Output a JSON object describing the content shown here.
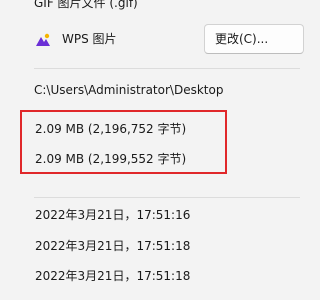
{
  "file_type": {
    "value": "GIF 图片文件 (.gif)"
  },
  "open_with": {
    "app_icon": "wps-picture-icon",
    "app_name": "WPS 图片",
    "change_button_label": "更改(C)..."
  },
  "location": {
    "value": "C:\\Users\\Administrator\\Desktop"
  },
  "size": {
    "value": "2.09 MB (2,196,752 字节)"
  },
  "size_on_disk": {
    "value": "2.09 MB (2,199,552 字节)"
  },
  "dates": {
    "created": "2022年3月21日，17:51:16",
    "modified": "2022年3月21日，17:51:18",
    "accessed": "2022年3月21日，17:51:18"
  },
  "colors": {
    "highlight_border": "#e0272a",
    "icon_purple": "#6b2fd6",
    "icon_yellow": "#f5b400"
  }
}
